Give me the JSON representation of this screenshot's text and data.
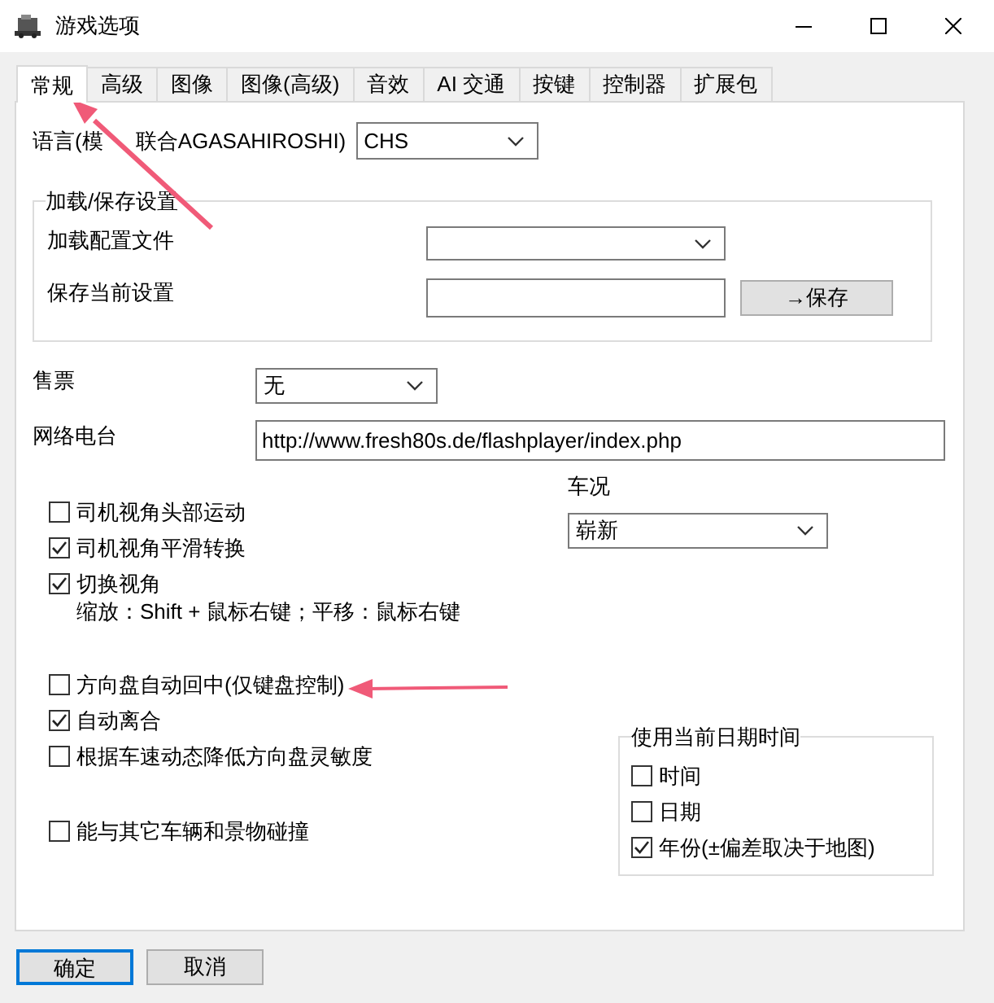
{
  "window": {
    "title": "游戏选项"
  },
  "tabs": [
    {
      "label": "常规",
      "selected": true
    },
    {
      "label": "高级",
      "selected": false
    },
    {
      "label": "图像",
      "selected": false
    },
    {
      "label": "图像(高级)",
      "selected": false
    },
    {
      "label": "音效",
      "selected": false
    },
    {
      "label": "AI 交通",
      "selected": false
    },
    {
      "label": "按键",
      "selected": false
    },
    {
      "label": "控制器",
      "selected": false
    },
    {
      "label": "扩展包",
      "selected": false
    }
  ],
  "language": {
    "label_parts": [
      "语言(模",
      "联合AGASAHIROSHI)"
    ],
    "value": "CHS"
  },
  "load_save": {
    "title": "加载/保存设置",
    "load_label": "加载配置文件",
    "save_label": "保存当前设置",
    "save_button": "→保存"
  },
  "ticketing": {
    "label": "售票",
    "value": "无"
  },
  "web_radio": {
    "label": "网络电台",
    "value": "http://www.fresh80s.de/flashplayer/index.php"
  },
  "option_groups": [
    [
      {
        "label": "司机视角头部运动",
        "checked": false
      },
      {
        "label": "司机视角平滑转换",
        "checked": true
      },
      {
        "label": "切换视角",
        "note": "缩放：Shift + 鼠标右键；平移：鼠标右键",
        "checked": true
      }
    ],
    [
      {
        "label": "方向盘自动回中(仅键盘控制)",
        "checked": false
      },
      {
        "label": "自动离合",
        "checked": true
      },
      {
        "label": "根据车速动态降低方向盘灵敏度",
        "checked": false
      }
    ],
    [
      {
        "label": "能与其它车辆和景物碰撞",
        "checked": false
      }
    ]
  ],
  "condition": {
    "label": "车况",
    "value": "崭新"
  },
  "date_time": {
    "title": "使用当前日期时间",
    "options": [
      {
        "label": "时间",
        "checked": false
      },
      {
        "label": "日期",
        "checked": false
      },
      {
        "label": "年份(±偏差取决于地图)",
        "checked": true
      }
    ]
  },
  "buttons": [
    {
      "label": "确定",
      "default": true
    },
    {
      "label": "取消",
      "default": false
    }
  ]
}
